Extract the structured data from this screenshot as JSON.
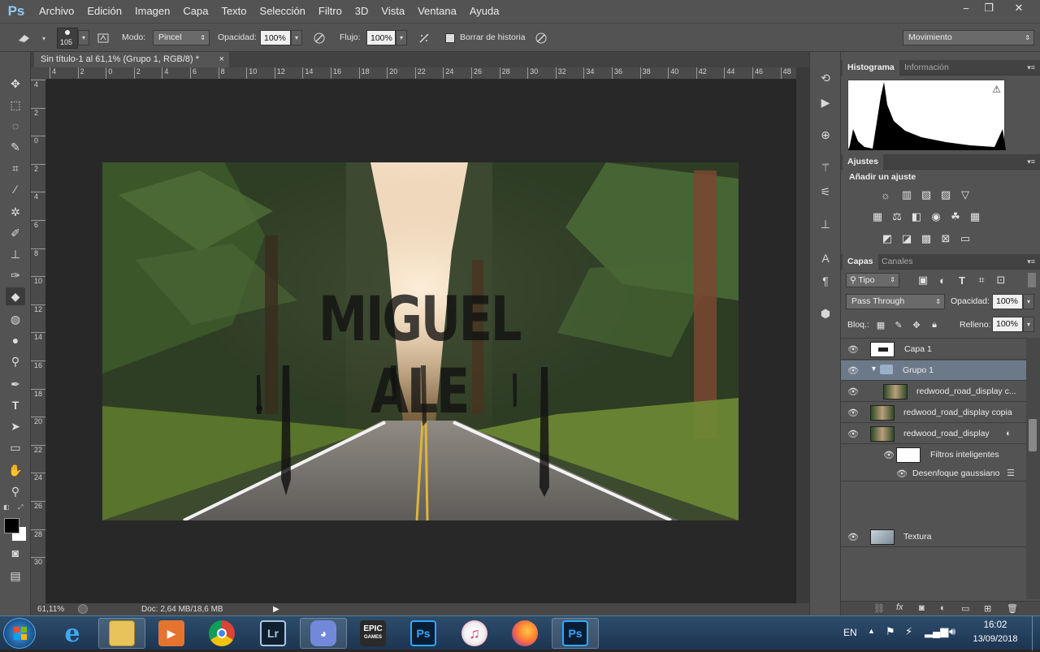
{
  "app": {
    "logo": "Ps"
  },
  "menu": [
    "Archivo",
    "Edición",
    "Imagen",
    "Capa",
    "Texto",
    "Selección",
    "Filtro",
    "3D",
    "Vista",
    "Ventana",
    "Ayuda"
  ],
  "window_controls": {
    "minimize": "−",
    "restore": "❐",
    "close": "✕"
  },
  "options_bar": {
    "brush_size": "105",
    "mode_label": "Modo:",
    "mode_value": "Pincel",
    "opacity_label": "Opacidad:",
    "opacity_value": "100%",
    "flow_label": "Flujo:",
    "flow_value": "100%",
    "erase_history_label": "Borrar de historia",
    "workspace_value": "Movimiento"
  },
  "document": {
    "tab_title": "Sin título-1 al 61,1% (Grupo 1, RGB/8) *",
    "tab_close": "×",
    "overlay_text": "MIGUEL ALE",
    "ruler_h": [
      "4",
      "2",
      "0",
      "2",
      "4",
      "6",
      "8",
      "10",
      "12",
      "14",
      "16",
      "18",
      "20",
      "22",
      "24",
      "26",
      "28",
      "30",
      "32",
      "34",
      "36",
      "38",
      "40",
      "42",
      "44",
      "46",
      "48"
    ],
    "ruler_v": [
      "4",
      "2",
      "0",
      "2",
      "4",
      "6",
      "8",
      "10",
      "12",
      "14",
      "16",
      "18",
      "20",
      "22",
      "24",
      "26",
      "28",
      "30"
    ]
  },
  "status": {
    "zoom": "61,11%",
    "doc_info": "Doc: 2,64 MB/18,6 MB"
  },
  "panels": {
    "histogram": {
      "tab_active": "Histograma",
      "tab_inactive": "Información",
      "warning": "⚠"
    },
    "adjustments": {
      "tab": "Ajustes",
      "heading": "Añadir un ajuste"
    },
    "layers": {
      "tab_active": "Capas",
      "tab_inactive": "Canales",
      "filter_kind": "Tipo",
      "blend_mode": "Pass Through",
      "opacity_label": "Opacidad:",
      "opacity_value": "100%",
      "lock_label": "Bloq.:",
      "fill_label": "Relleno:",
      "fill_value": "100%",
      "items": [
        {
          "name": "Capa 1"
        },
        {
          "name": "Grupo 1"
        },
        {
          "name": "redwood_road_display c..."
        },
        {
          "name": "redwood_road_display copia"
        },
        {
          "name": "redwood_road_display"
        },
        {
          "name": "Filtros inteligentes"
        },
        {
          "name": "Desenfoque gaussiano"
        },
        {
          "name": "Textura"
        }
      ]
    }
  },
  "taskbar": {
    "apps": [
      "Internet Explorer",
      "Explorador de archivos",
      "Reproductor multimedia",
      "Google Chrome",
      "Lightroom",
      "Discord",
      "Epic Games",
      "Photoshop Instalador",
      "iTunes",
      "Firefox",
      "Photoshop"
    ],
    "lr_label": "Lr",
    "epic_label": "EPIC",
    "epic_sub": "GAMES",
    "ps_label": "Ps",
    "lang": "EN",
    "time": "16:02",
    "date": "13/09/2018"
  },
  "colors": {
    "ps_blue": "#8fcaf7",
    "selected_layer": "#6c7989",
    "panel_bg": "#535353"
  }
}
